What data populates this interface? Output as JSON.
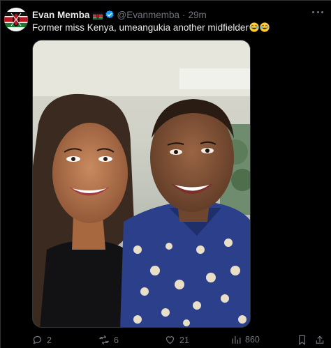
{
  "tweet": {
    "display_name": "Evan Memba",
    "handle": "@Evanmemba",
    "separator": "·",
    "time": "29m",
    "text": "Former miss Kenya, umeangukia another midfielder",
    "verified": true,
    "name_emoji": "kenya-flag",
    "text_emojis": [
      "joy-icon",
      "joy-icon"
    ]
  },
  "actions": {
    "replies": "2",
    "retweets": "6",
    "likes": "21",
    "views": "860"
  },
  "colors": {
    "background": "#000000",
    "text": "#e7e9ea",
    "muted": "#71767b",
    "verified": "#1d9bf0"
  }
}
